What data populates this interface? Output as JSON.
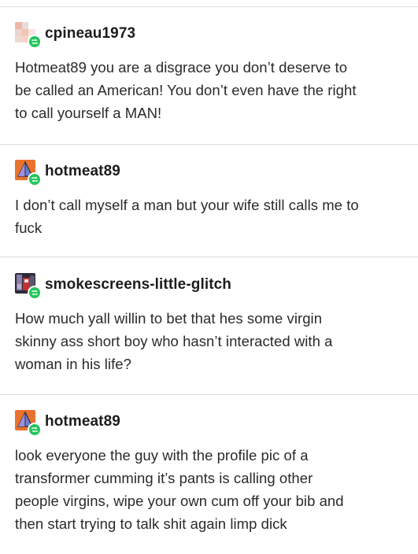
{
  "posts": [
    {
      "username": "cpineau1973",
      "avatar_icon": "pixelated-avatar-icon",
      "lines": [
        "Hotmeat89 you are a disgrace you don’t deserve to",
        "be called an American!  You don’t even have the right",
        "to call yourself a MAN!"
      ]
    },
    {
      "username": "hotmeat89",
      "avatar_icon": "pyramid-avatar-icon",
      "lines": [
        "I don’t call myself a man but your wife still calls me to",
        "fuck"
      ]
    },
    {
      "username": "smokescreens-little-glitch",
      "avatar_icon": "robot-avatar-icon",
      "lines": [
        "How much yall willin to bet that hes some virgin",
        "skinny ass short boy who hasn’t interacted with a",
        "woman in his life?"
      ]
    },
    {
      "username": "hotmeat89",
      "avatar_icon": "pyramid-avatar-icon",
      "lines": [
        "look everyone the guy with the profile pic of a",
        "transformer cumming it’s pants is calling other",
        "people virgins, wipe your own cum off your bib and",
        "then start trying to talk shit again limp dick"
      ]
    }
  ],
  "colors": {
    "reblog_badge": "#27c35d",
    "text": "#2a2a2a",
    "separator": "#dcdcdc"
  }
}
